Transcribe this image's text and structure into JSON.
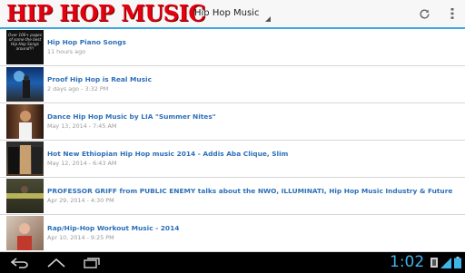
{
  "app": {
    "logo_text": "HIP HOP MUSIC",
    "spinner_value": "Hip Hop Music",
    "accent": "#3fa9df",
    "logo_color": "#e3000f"
  },
  "icons": [
    "refresh-icon",
    "overflow-menu-icon",
    "back-icon",
    "home-icon",
    "recent-apps-icon",
    "wifi-icon",
    "battery-icon"
  ],
  "videos": [
    {
      "title": "Hip Hop Piano Songs",
      "meta": "11 hours ago",
      "thumb_text": "Over 100+ pages of some the best Hip Hop Songs around!!!"
    },
    {
      "title": "Proof Hip Hop is Real Music",
      "meta": "2 days ago - 3:32 PM"
    },
    {
      "title": "Dance Hip Hop Music by LIA \"Summer Nites\"",
      "meta": "May 13, 2014 - 7:45 AM"
    },
    {
      "title": "Hot New Ethiopian Hip Hop music 2014 - Addis Aba Clique, Slim",
      "meta": "May 12, 2014 - 6:43 AM"
    },
    {
      "title": "PROFESSOR GRIFF from PUBLIC ENEMY talks about the NWO, ILLUMINATI, Hip Hop Music Industry & Future",
      "meta": "Apr 29, 2014 - 4:30 PM"
    },
    {
      "title": "Rap/Hip-Hop Workout Music - 2014",
      "meta": "Apr 10, 2014 - 9:25 PM"
    }
  ],
  "status_bar": {
    "time": "1:02"
  }
}
